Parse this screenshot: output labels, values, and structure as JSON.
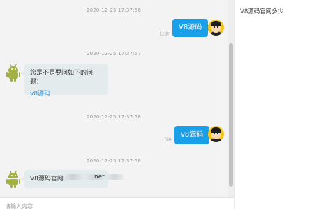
{
  "messages": [
    {
      "timestamp": "2020-12-25 17:37:56",
      "sender": "user",
      "text": "V8源码",
      "status": "已读"
    },
    {
      "timestamp": "2020-12-25 17:37:57",
      "sender": "bot",
      "text": "您是不是要问如下的问题：",
      "link": "v8源码"
    },
    {
      "timestamp": "2020-12-25 17:37:58",
      "sender": "user",
      "text": "v8源码",
      "status": "已读"
    },
    {
      "timestamp": "2020-12-25 17:37:58",
      "sender": "bot",
      "text": "V8源码官网",
      "text_tail": "net"
    }
  ],
  "input": {
    "placeholder": "请输入内容"
  },
  "sidebar": {
    "items": [
      {
        "label": "V8源码官网多少"
      }
    ]
  },
  "colors": {
    "user_bubble": "#1aa0e8",
    "bot_bubble": "#e4ebec",
    "link": "#2e90d8",
    "user_avatar": "#f2c420",
    "bot_avatar": "#a3b043"
  }
}
